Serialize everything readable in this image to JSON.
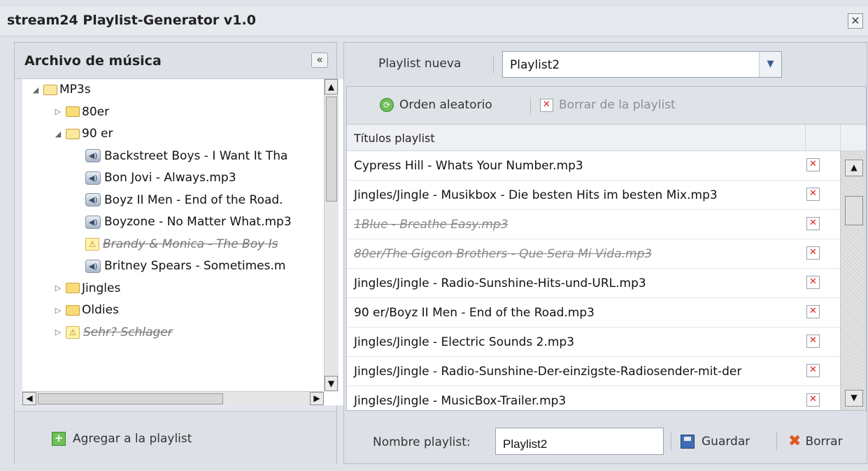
{
  "window": {
    "title": "stream24 Playlist-Generator v1.0",
    "close_glyph": "✕"
  },
  "left": {
    "title": "Archivo de música",
    "collapse_glyph": "«",
    "tree": [
      {
        "label": "MP3s",
        "kind": "folder-open",
        "toggle": "◢",
        "level": 0
      },
      {
        "label": "80er",
        "kind": "folder",
        "toggle": "▷",
        "level": 1
      },
      {
        "label": "90 er",
        "kind": "folder-open",
        "toggle": "◢",
        "level": 1
      },
      {
        "label": "Backstreet Boys - I Want It Tha",
        "kind": "audio",
        "level": 2
      },
      {
        "label": "Bon Jovi - Always.mp3",
        "kind": "audio",
        "level": 2
      },
      {
        "label": "Boyz II Men - End of the Road.",
        "kind": "audio",
        "level": 2
      },
      {
        "label": "Boyzone - No Matter What.mp3",
        "kind": "audio",
        "level": 2
      },
      {
        "label": "Brandy & Monica - The Boy Is",
        "kind": "warning",
        "level": 2
      },
      {
        "label": "Britney Spears - Sometimes.m",
        "kind": "audio",
        "level": 2
      },
      {
        "label": "Jingles",
        "kind": "folder",
        "toggle": "▷",
        "level": 1
      },
      {
        "label": "Oldies",
        "kind": "folder",
        "toggle": "▷",
        "level": 1
      },
      {
        "label": "Sehr? Schlager",
        "kind": "warning-folder",
        "toggle": "▷",
        "level": 1
      }
    ],
    "add_button": "Agregar a la playlist"
  },
  "right": {
    "new_playlist_label": "Playlist nueva",
    "playlist_select": "Playlist2",
    "toolbar": {
      "shuffle": "Orden aleatorio",
      "remove": "Borrar de la playlist"
    },
    "column_header": "Títulos playlist",
    "rows": [
      {
        "title": "Cypress Hill - Whats Your Number.mp3",
        "missing": false
      },
      {
        "title": "Jingles/Jingle - Musikbox - Die besten Hits im besten Mix.mp3",
        "missing": false
      },
      {
        "title": "1Blue - Breathe Easy.mp3",
        "missing": true
      },
      {
        "title": "80er/The Gigcon Brothers - Que Sera Mi Vida.mp3",
        "missing": true
      },
      {
        "title": "Jingles/Jingle - Radio-Sunshine-Hits-und-URL.mp3",
        "missing": false
      },
      {
        "title": "90 er/Boyz II Men - End of the Road.mp3",
        "missing": false
      },
      {
        "title": "Jingles/Jingle - Electric Sounds 2.mp3",
        "missing": false
      },
      {
        "title": "Jingles/Jingle - Radio-Sunshine-Der-einzigste-Radiosender-mit-der",
        "missing": false
      },
      {
        "title": "Jingles/Jingle - MusicBox-Trailer.mp3",
        "missing": false
      }
    ],
    "name_label": "Nombre playlist:",
    "name_value": "Playlist2",
    "save_button": "Guardar",
    "delete_button": "Borrar"
  },
  "colors": {
    "accent": "#3c5c90",
    "delete_red": "#dd2222",
    "add_green": "#6fbf5a"
  },
  "icons": {
    "folder": "folder-icon",
    "audio": "speaker-icon",
    "warning": "warning-icon",
    "save": "floppy-icon",
    "delete": "x-icon"
  }
}
